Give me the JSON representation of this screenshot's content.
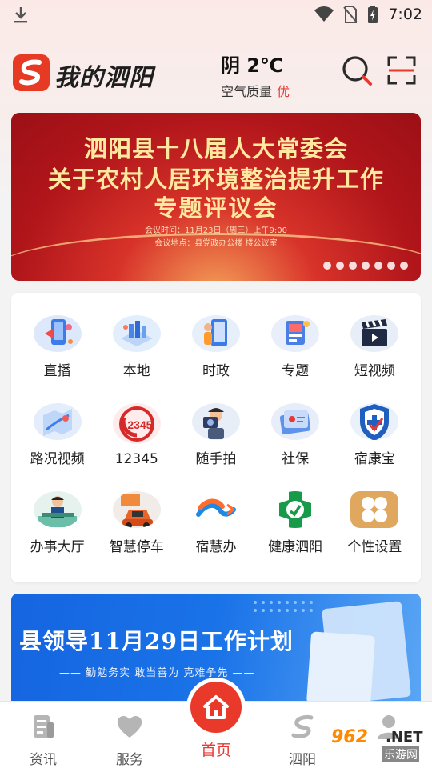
{
  "status_bar": {
    "time": "7:02"
  },
  "header": {
    "app_title": "我的泗阳",
    "weather": {
      "condition_temp": "阴 2℃",
      "air_label": "空气质量",
      "air_value": "优"
    }
  },
  "banner": {
    "line1": "泗阳县十八届人大常委会",
    "line2": "关于农村人居环境整治提升工作",
    "line3": "专题评议会",
    "meeting_time": "会议时间：11月23日（周三）上午9:00",
    "meeting_place": "会议地点：县党政办公楼  楼公议室",
    "dot_count": 7
  },
  "services": [
    {
      "label": "直播",
      "icon": "live-broadcast-icon"
    },
    {
      "label": "本地",
      "icon": "local-city-icon"
    },
    {
      "label": "时政",
      "icon": "politics-news-icon"
    },
    {
      "label": "专题",
      "icon": "special-topic-icon"
    },
    {
      "label": "短视频",
      "icon": "clapperboard-icon"
    },
    {
      "label": "路况视频",
      "icon": "road-map-icon"
    },
    {
      "label": "12345",
      "icon": "hotline-12345-icon"
    },
    {
      "label": "随手拍",
      "icon": "camera-photographer-icon"
    },
    {
      "label": "社保",
      "icon": "social-security-card-icon"
    },
    {
      "label": "宿康宝",
      "icon": "shield-cross-icon"
    },
    {
      "label": "办事大厅",
      "icon": "service-hall-icon"
    },
    {
      "label": "智慧停车",
      "icon": "smart-parking-car-icon"
    },
    {
      "label": "宿慧办",
      "icon": "suhuiban-logo-icon"
    },
    {
      "label": "健康泗阳",
      "icon": "health-cross-icon"
    },
    {
      "label": "个性设置",
      "icon": "settings-grid-icon"
    }
  ],
  "banner2": {
    "title": "县领导11月29日工作计划",
    "subtitle": "—— 勤勉务实  敢当善为  克难争先 ——"
  },
  "bottom_nav": {
    "items": [
      {
        "label": "资讯",
        "icon": "news-icon"
      },
      {
        "label": "服务",
        "icon": "heart-icon"
      },
      {
        "label": "首页",
        "icon": "home-icon"
      },
      {
        "label": "泗阳",
        "icon": "siyang-logo-icon"
      },
      {
        "label": "",
        "icon": "user-icon"
      }
    ]
  },
  "watermark": {
    "brand": "962",
    "net": ".NET",
    "sub": "乐游网"
  },
  "colors": {
    "accent_red": "#e8392a",
    "banner_blue": "#1a73e8"
  }
}
